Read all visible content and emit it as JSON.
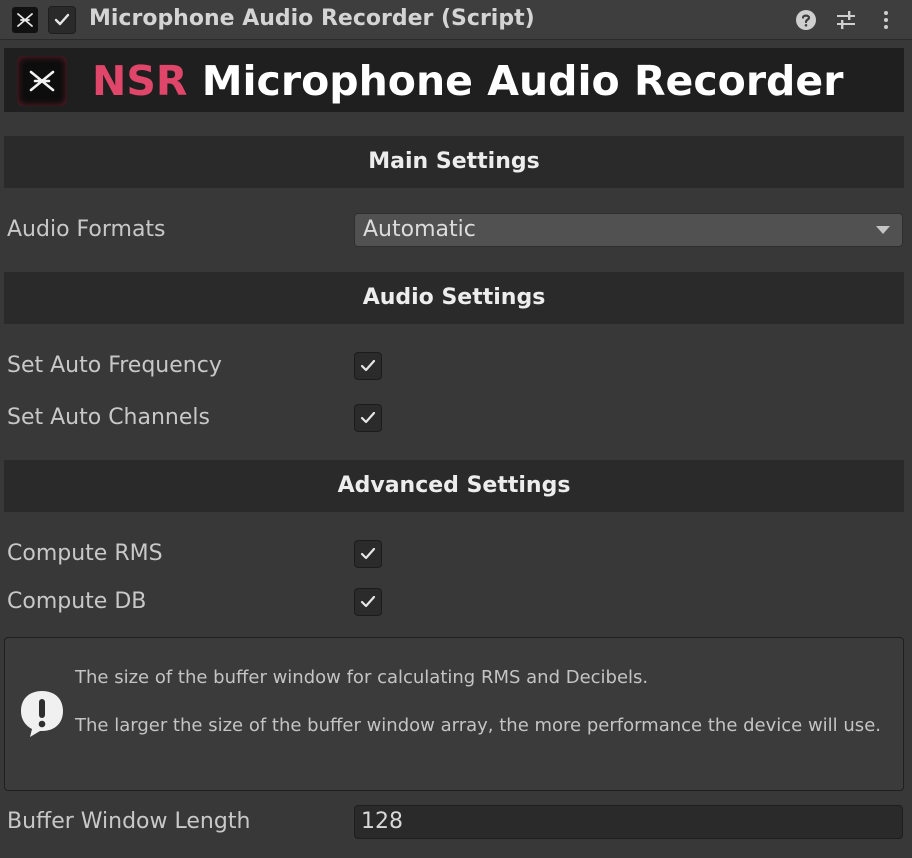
{
  "component": {
    "title": "Microphone Audio Recorder (Script)",
    "enabled": true
  },
  "banner": {
    "brand": "NSR",
    "title": " Microphone Audio Recorder",
    "brand_color": "#e0466a"
  },
  "sections": {
    "main": "Main Settings",
    "audio": "Audio Settings",
    "advanced": "Advanced Settings"
  },
  "fields": {
    "audio_formats": {
      "label": "Audio Formats",
      "value": "Automatic"
    },
    "set_auto_frequency": {
      "label": "Set Auto Frequency",
      "checked": true
    },
    "set_auto_channels": {
      "label": "Set Auto Channels",
      "checked": true
    },
    "compute_rms": {
      "label": "Compute RMS",
      "checked": true
    },
    "compute_db": {
      "label": "Compute DB",
      "checked": true
    },
    "buffer_window_length": {
      "label": "Buffer Window Length",
      "value": "128"
    }
  },
  "help": {
    "line1": "The size of the buffer window for calculating RMS and Decibels.",
    "line2": "The larger the size of the buffer window array, the more performance the device will use."
  },
  "icons": {
    "component": "nsr-logo-icon",
    "help": "help-icon",
    "presets": "presets-icon",
    "menu": "kebab-menu-icon",
    "info": "warning-icon"
  }
}
